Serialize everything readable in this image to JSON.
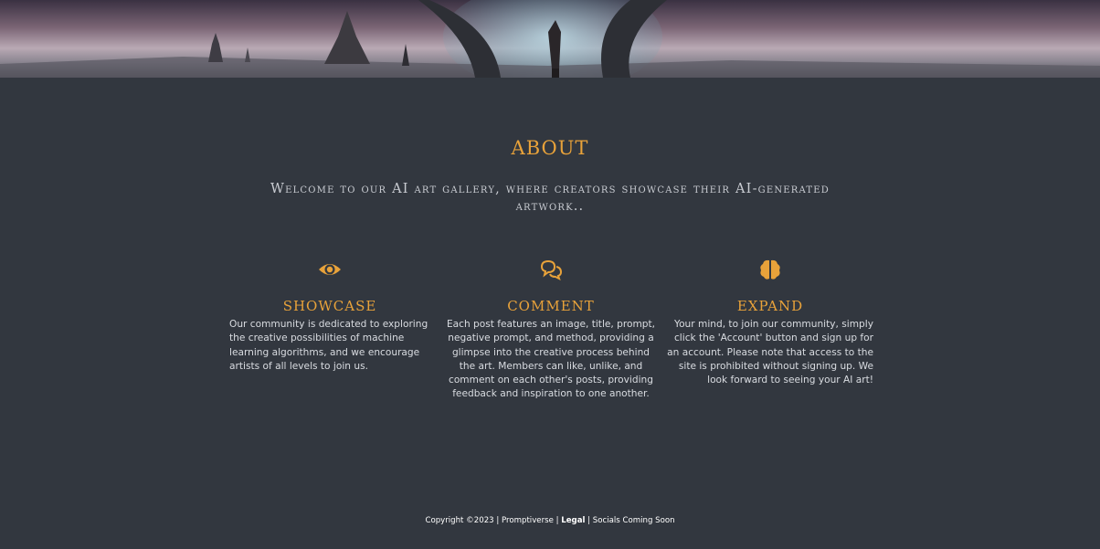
{
  "banner": {
    "icon": "sci-fi-landscape-image"
  },
  "about": {
    "title": "ABOUT",
    "subtitle": "Welcome to our AI art gallery, where creators showcase their AI-generated artwork.."
  },
  "features": [
    {
      "icon": "eye-icon",
      "heading": "SHOWCASE",
      "text": "Our community is dedicated to exploring the creative possibilities of machine learning algorithms, and we encourage artists of all levels to join us."
    },
    {
      "icon": "comments-icon",
      "heading": "COMMENT",
      "text": "Each post features an image, title, prompt, negative prompt, and method, providing a glimpse into the creative process behind the art. Members can like, unlike, and comment on each other's posts, providing feedback and inspiration to one another."
    },
    {
      "icon": "brain-icon",
      "heading": "EXPAND",
      "text": "Your mind, to join our community, simply click the 'Account' button and sign up for an account. Please note that access to the site is prohibited without signing up. We look forward to seeing your AI art!"
    }
  ],
  "footer": {
    "copyright": "Copyright ©2023 | Promptiverse |",
    "legal": "Legal",
    "socials": "| Socials Coming Soon"
  },
  "colors": {
    "accent": "#e8a23a",
    "background": "#32373f"
  }
}
